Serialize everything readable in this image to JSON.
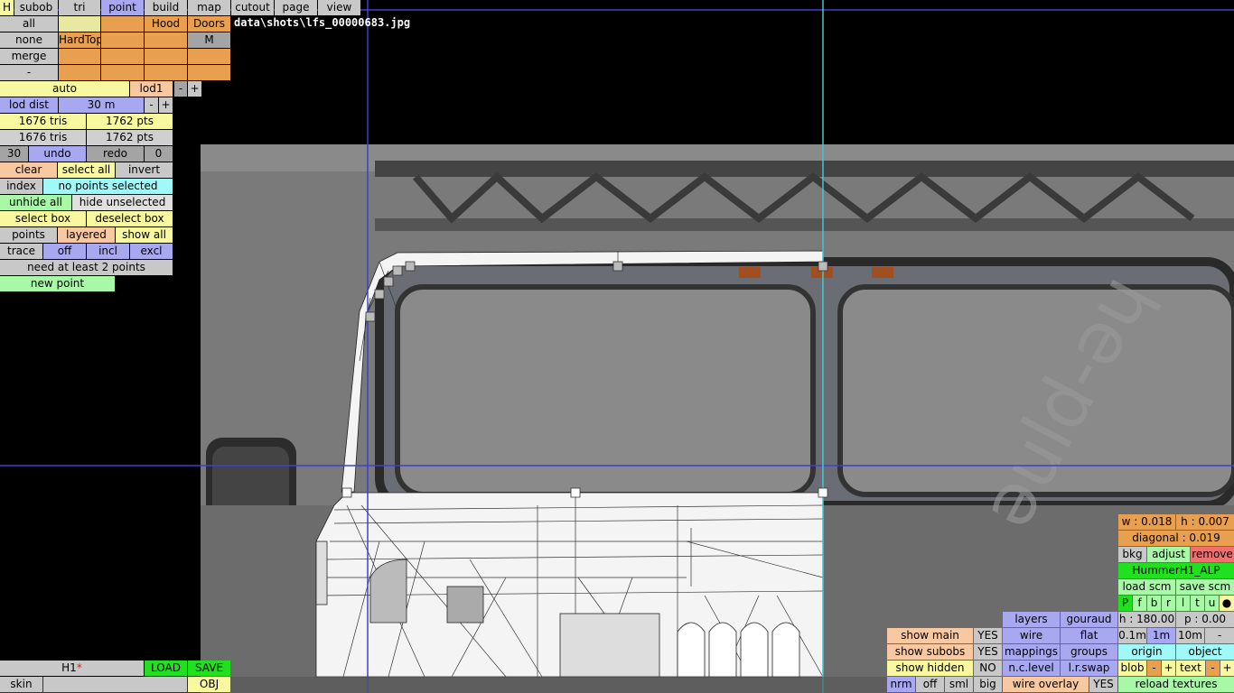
{
  "filename": "data\\shots\\lfs_00000683.jpg",
  "top_menu": [
    "H",
    "subob",
    "tri",
    "point",
    "build",
    "map",
    "cutout",
    "page",
    "view"
  ],
  "subob": {
    "row1": [
      "all",
      "",
      "",
      "Hood",
      "Doors"
    ],
    "row2": [
      "none",
      "HardTop",
      "",
      "",
      "M"
    ],
    "row3": [
      "merge",
      "",
      "",
      "",
      ""
    ],
    "row4": [
      "-",
      "",
      "",
      "",
      ""
    ]
  },
  "lod": {
    "mode": "auto",
    "level": "lod1",
    "minus": "-",
    "plus": "+"
  },
  "lod_dist": {
    "label": "lod dist",
    "value": "30 m",
    "minus": "-",
    "plus": "+"
  },
  "stats1": {
    "tris": "1676 tris",
    "pts": "1762 pts"
  },
  "stats2": {
    "tris": "1676 tris",
    "pts": "1762 pts"
  },
  "undo_row": {
    "count": "30",
    "undo": "undo",
    "redo": "redo",
    "redo_count": "0"
  },
  "sel_row": {
    "clear": "clear",
    "select_all": "select all",
    "invert": "invert"
  },
  "index_row": {
    "index": "index",
    "status": "no points selected"
  },
  "hide_row": {
    "unhide_all": "unhide all",
    "hide_unselected": "hide unselected"
  },
  "box_row": {
    "select_box": "select box",
    "deselect_box": "deselect box"
  },
  "points_row": {
    "points": "points",
    "layered": "layered",
    "show_all": "show all"
  },
  "trace_row": {
    "trace": "trace",
    "off": "off",
    "incl": "incl",
    "excl": "excl"
  },
  "hint": "need at least 2 points",
  "new_point": "new point",
  "bottom_left": {
    "name": "H1",
    "dirty": "*",
    "load": "LOAD",
    "save": "SAVE",
    "skin": "skin",
    "obj": "OBJ"
  },
  "right_panel": {
    "w": "w : 0.018",
    "h": "h : 0.007",
    "diagonal": "diagonal : 0.019",
    "bkg": "bkg",
    "adjust": "adjust",
    "remove": "remove",
    "model": "HummerH1_ALP",
    "load_scm": "load scm",
    "save_scm": "save scm",
    "flags": [
      "P",
      "f",
      "b",
      "r",
      "l",
      "t",
      "u",
      "●"
    ],
    "heading": "h : 180.00",
    "pitch": "p : 0.00",
    "step": [
      "0.1m",
      "1m",
      "10m",
      "-"
    ],
    "origin": "origin",
    "object": "object",
    "blob": "blob",
    "text": "text",
    "minus": "-",
    "plus": "+",
    "reload_textures": "reload textures"
  },
  "view_opts": {
    "show_main": "show main",
    "show_main_v": "YES",
    "show_subobs": "show subobs",
    "show_subobs_v": "YES",
    "show_hidden": "show hidden",
    "show_hidden_v": "NO",
    "layers": "layers",
    "gouraud": "gouraud",
    "wire": "wire",
    "flat": "flat",
    "mappings": "mappings",
    "groups": "groups",
    "nc_level": "n.c.level",
    "lr_swap": "l.r.swap",
    "nrm": "nrm",
    "off": "off",
    "sml": "sml",
    "big": "big",
    "wire_overlay": "wire overlay",
    "wire_overlay_v": "YES"
  },
  "colors": {
    "guide_blue": "#4040d0",
    "guide_cyan": "#40c8d0",
    "accent_green": "#20e020"
  }
}
